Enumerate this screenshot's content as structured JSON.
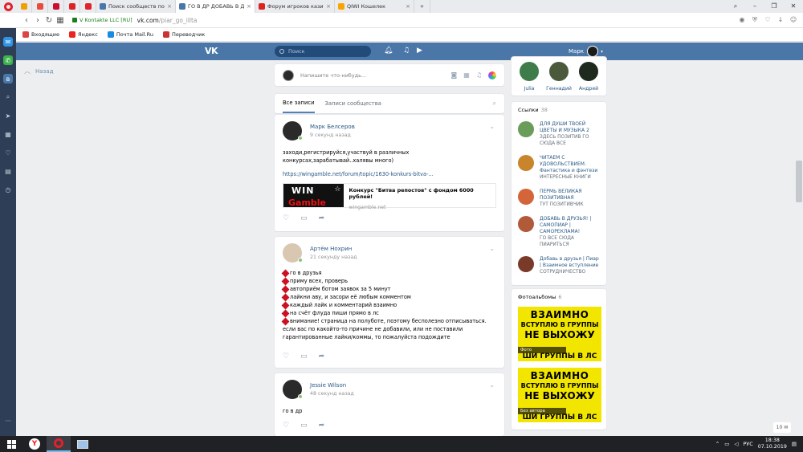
{
  "browser": {
    "tabs": [
      {
        "title": "",
        "color": "#f0a000",
        "pinned": true
      },
      {
        "title": "",
        "color": "#e94b3c",
        "pinned": true
      },
      {
        "title": "",
        "color": "#c8102e",
        "pinned": true
      },
      {
        "title": "",
        "color": "#d22",
        "pinned": true
      },
      {
        "title": "",
        "color": "#e0222c",
        "pinned": true
      },
      {
        "title": "Поиск сообществ по запр",
        "color": "#4a76a8",
        "active": false
      },
      {
        "title": "ГО В ДР ДОБАВЬ В ДРУЗЬЯ",
        "color": "#4a76a8",
        "active": true
      },
      {
        "title": "Форум игроков казино",
        "color": "#d22",
        "active": false
      },
      {
        "title": "QIWI Кошелек",
        "color": "#f7a600",
        "active": false
      }
    ],
    "security_label": "V Kontakte LLC [RU]",
    "url_host": "vk.com",
    "url_path": "/piar_go_illta",
    "bookmarks": [
      {
        "label": "Входящие",
        "color": "#d44"
      },
      {
        "label": "Яндекс",
        "color": "#e22"
      },
      {
        "label": "Почта Mail.Ru",
        "color": "#168de2"
      },
      {
        "label": "Переводчик",
        "color": "#c33"
      }
    ]
  },
  "vk": {
    "search_placeholder": "Поиск",
    "user_name": "Марк",
    "back_label": "Назад",
    "composer_placeholder": "Напишите что-нибудь...",
    "feed_tabs": [
      "Все записи",
      "Записи сообщества"
    ],
    "posts": [
      {
        "author": "Марк Белсеров",
        "time": "9 секунд назад",
        "text": "заходи,регистрируйся,участвуй в различных конкурсах,зарабатывай..халявы много)",
        "link": "https://wingamble.net/forum/topic/1630-konkurs-bitva-...",
        "snippet_title": "Конкурс \"Битва репостов\" с фондом 6000 рублей!",
        "snippet_domain": "wingamble.net",
        "snippet_img_top": "WIN",
        "snippet_img_bottom": "Gamble"
      },
      {
        "author": "Артём Нохрин",
        "time": "21 секунду назад",
        "lines": [
          "го в друзья",
          "приму всех, проверь",
          "автоприём ботом заявок за 5 минут",
          "лайкни аву, и засори её любым комментом",
          "каждый лайк и комментарий взаимно",
          "на счёт флуда пиши прямо в лс",
          "внимание! страница на полуботе, поэтому бесполезно отписываться. если вас по какойто-то причине не добавили, или не поставили гарантированные лайки/коммы, то пожалуйста подождите"
        ]
      },
      {
        "author": "Jessie Wilson",
        "time": "48 секунд назад",
        "text": "го в др"
      }
    ],
    "friends": [
      {
        "name": "Julia",
        "color": "#3e7d4a"
      },
      {
        "name": "Геннадий",
        "color": "#4b5a3a"
      },
      {
        "name": "Андрей",
        "color": "#1d2a1d"
      }
    ],
    "links_title": "Ссылки",
    "links_count": "38",
    "groups": [
      {
        "name": "ДЛЯ ДУШИ ТВОЕЙ ЦВЕТЫ И МУЗЫКА 2",
        "desc": "ЗДЕСЬ ПОЗИТИВ ГО СЮДА ВСЕ",
        "color": "#6a9c5a"
      },
      {
        "name": "ЧИТАЕМ С УДОВОЛЬСТВИЕМ. Фантастика и фэнтези",
        "desc": "ИНТЕРЕСНЫЕ КНИГИ",
        "color": "#c9852b"
      },
      {
        "name": "ПЕРМЬ ВЕЛИКАЯ ПОЗИТИВНАЯ",
        "desc": "ТУТ ПОЗИТИВЧИК",
        "color": "#d4643a"
      },
      {
        "name": "ДОБАВЬ В ДРУЗЬЯ! | САМОПИАР | САМОРЕКЛАМА!",
        "desc": "ГО ВСЕ СЮДА ПИАРИТЬСЯ",
        "color": "#b05a3a"
      },
      {
        "name": "Добавь в друзья | Пиар | Взаимное вступление",
        "desc": "СОТРУДНИЧЕСТВО",
        "color": "#7a3a2a"
      }
    ],
    "albums_title": "Фотоальбомы",
    "albums_count": "6",
    "albums": [
      {
        "l1": "ВЗАИМНО",
        "l2": "ВСТУПЛЮ В ГРУППЫ",
        "l3": "НЕ ВЫХОЖУ",
        "l4": "ШИ ГРУППЫ В ЛС",
        "cap": "Фото"
      },
      {
        "l1": "ВЗАИМНО",
        "l2": "ВСТУПЛЮ В ГРУППЫ",
        "l3": "НЕ ВЫХОЖУ",
        "l4": "ШИ ГРУППЫ В ЛС",
        "cap": "Без автора"
      }
    ],
    "page_badge": "10"
  },
  "taskbar": {
    "lang": "РУС",
    "time": "18:38",
    "date": "07.10.2019"
  }
}
